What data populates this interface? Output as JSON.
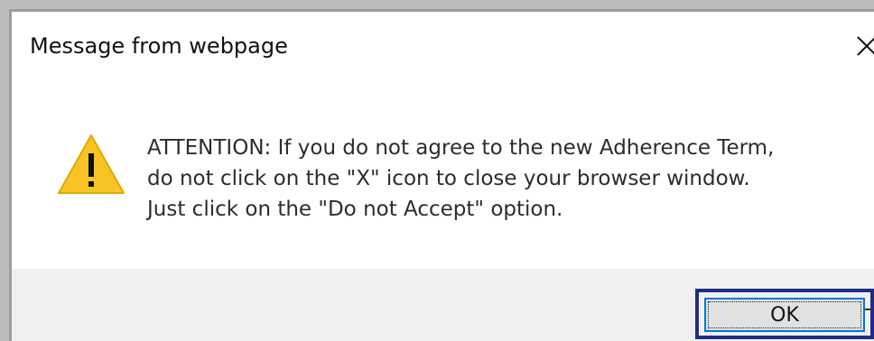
{
  "dialog": {
    "title": "Message from webpage",
    "close_icon": "close-icon",
    "warning_icon": "warning-icon",
    "message_lines": [
      "ATTENTION: If you do not agree to the new Adherence Term,",
      "do not click on the \"X\" icon to close your browser window.",
      "Just click on the \"Do not Accept\" option."
    ],
    "ok_label": "OK"
  },
  "colors": {
    "highlight_border": "#1f2d86",
    "button_border": "#0078d7",
    "warning_fill": "#f7c325",
    "footer_bg": "#f0f0f0"
  }
}
